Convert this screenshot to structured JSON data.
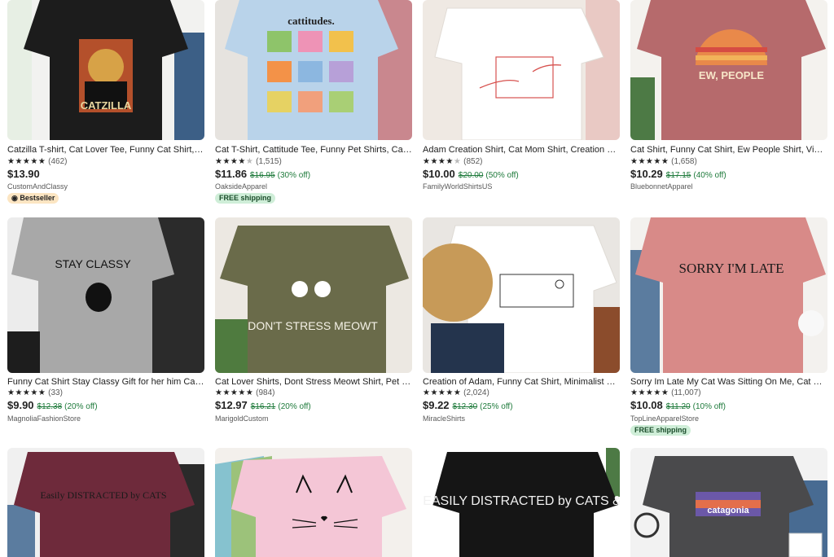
{
  "products": [
    {
      "title": "Catzilla T-shirt, Cat Lover Tee, Funny Cat Shirt, Catzilla Shirt",
      "stars": "★★★★★",
      "reviews": "(462)",
      "price": "$13.90",
      "orig": "",
      "off": "",
      "shop": "CustomAndClassy",
      "badge": "Bestseller",
      "badge_type": "best",
      "img": {
        "bg": "#f2f2f0",
        "shirt": "#1c1c1c",
        "print": "CATZILLA"
      }
    },
    {
      "title": "Cat T-Shirt, Cattitude Tee, Funny Pet Shirts, Cat Lover Gift",
      "stars": "★★★★",
      "half": "★",
      "reviews": "(1,515)",
      "price": "$11.86",
      "orig": "$16.95",
      "off": "(30% off)",
      "shop": "OaksideApparel",
      "badge": "FREE shipping",
      "badge_type": "free",
      "img": {
        "bg": "#e6e3df",
        "shirt": "#b9d3ea",
        "print": "cattitudes."
      }
    },
    {
      "title": "Adam Creation Shirt, Cat Mom Shirt, Creation of Adam Cat",
      "stars": "★★★★",
      "half": "★",
      "reviews": "(852)",
      "price": "$10.00",
      "orig": "$20.00",
      "off": "(50% off)",
      "shop": "FamilyWorldShirtsUS",
      "badge": "",
      "badge_type": "",
      "img": {
        "bg": "#efe9e3",
        "shirt": "#ffffff",
        "print": ""
      }
    },
    {
      "title": "Cat Shirt, Funny Cat Shirt, Ew People Shirt, Vintage Cat",
      "stars": "★★★★★",
      "reviews": "(1,658)",
      "price": "$10.29",
      "orig": "$17.15",
      "off": "(40% off)",
      "shop": "BluebonnetApparel",
      "badge": "",
      "badge_type": "",
      "img": {
        "bg": "#f4f2ee",
        "shirt": "#b66a6c",
        "print": "EW, PEOPLE"
      }
    },
    {
      "title": "Funny Cat Shirt Stay Classy Gift for her him Cat Lover",
      "stars": "★★★★★",
      "reviews": "(33)",
      "price": "$9.90",
      "orig": "$12.38",
      "off": "(20% off)",
      "shop": "MagnoliaFashionStore",
      "badge": "",
      "badge_type": "",
      "img": {
        "bg": "#ececec",
        "shirt": "#a8a8a8",
        "print": "STAY CLASSY"
      }
    },
    {
      "title": "Cat Lover Shirts, Dont Stress Meowt Shirt, Pet Lover Tee",
      "stars": "★★★★★",
      "reviews": "(984)",
      "price": "$12.97",
      "orig": "$16.21",
      "off": "(20% off)",
      "shop": "MarigoldCustom",
      "badge": "",
      "badge_type": "",
      "img": {
        "bg": "#ece8e2",
        "shirt": "#6a6b4a",
        "print": "DON'T STRESS MEOWT"
      }
    },
    {
      "title": "Creation of Adam, Funny Cat Shirt, Minimalist Cat Shirt",
      "stars": "★★★★★",
      "reviews": "(2,024)",
      "price": "$9.22",
      "orig": "$12.30",
      "off": "(25% off)",
      "shop": "MiracleShirts",
      "badge": "",
      "badge_type": "",
      "img": {
        "bg": "#e9e6e2",
        "shirt": "#ffffff",
        "print": ""
      }
    },
    {
      "title": "Sorry Im Late My Cat Was Sitting On Me, Cat Mom Shirt",
      "stars": "★★★★★",
      "reviews": "(11,007)",
      "price": "$10.08",
      "orig": "$11.20",
      "off": "(10% off)",
      "shop": "TopLineApparelStore",
      "badge": "FREE shipping",
      "badge_type": "free",
      "img": {
        "bg": "#f3f1ee",
        "shirt": "#d88a88",
        "print": "SORRY I'M LATE"
      }
    },
    {
      "title": "",
      "stars": "",
      "reviews": "",
      "price": "",
      "orig": "",
      "off": "",
      "shop": "",
      "badge": "",
      "badge_type": "",
      "img": {
        "bg": "#f0f0f0",
        "shirt": "#6e2a3b",
        "print": "Easily DISTRACTED by CATS"
      }
    },
    {
      "title": "",
      "stars": "",
      "reviews": "",
      "price": "",
      "orig": "",
      "off": "",
      "shop": "",
      "badge": "",
      "badge_type": "",
      "img": {
        "bg": "#f3f0ec",
        "shirt": "#f4c6d6",
        "print": ""
      }
    },
    {
      "title": "",
      "stars": "",
      "reviews": "",
      "price": "",
      "orig": "",
      "off": "",
      "shop": "",
      "badge": "",
      "badge_type": "",
      "img": {
        "bg": "#ffffff",
        "shirt": "#151515",
        "print": "EASILY DISTRACTED by CATS &"
      }
    },
    {
      "title": "",
      "stars": "",
      "reviews": "",
      "price": "",
      "orig": "",
      "off": "",
      "shop": "",
      "badge": "",
      "badge_type": "",
      "img": {
        "bg": "#f2f2f2",
        "shirt": "#4a4a4c",
        "print": "catagonia"
      }
    }
  ]
}
